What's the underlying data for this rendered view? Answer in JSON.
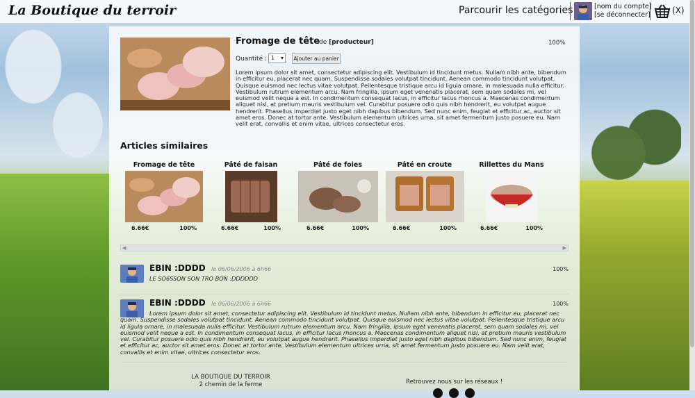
{
  "header": {
    "brand": "La Boutique du terroir",
    "browse_categories": "Parcourir les catégories",
    "account_name": "[nom du compte]",
    "logout": "[se déconnecter]",
    "cart_count": "(X)"
  },
  "product": {
    "title": "Fromage de tête",
    "by": "de",
    "producer": "[producteur]",
    "percent": "100%",
    "quantity_label": "Quantité :",
    "quantity_value": "1",
    "add_to_cart": "Ajouter au panier",
    "description": "Lorem ipsum dolor sit amet, consectetur adipiscing elit. Vestibulum id tincidunt metus. Nullam nibh ante, bibendum in efficitur eu, placerat nec quam. Suspendisse sodales volutpat tincidunt. Aenean commodo tincidunt volutpat. Quisque euismod nec lectus vitae volutpat. Pellentesque tristique arcu id ligula ornare, in malesuada nulla efficitur. Vestibulum rutrum elementum arcu. Nam fringilla, ipsum eget venenatis placerat, sem quam sodales mi, vel euismod velit neque a est. In condimentum consequat lacus, in efficitur lacus rhoncus a. Maecenas condimentum aliquet nisl, at pretium mauris vestibulum vel. Curabitur posuere odio quis nibh hendrerit, eu volutpat augue hendrerit. Phasellus imperdiet justo eget nibh dapibus bibendum. Sed nunc enim, feugiat et efficitur ac, auctor sit amet eros. Donec at tortor ante. Vestibulum elementum ultrices urna, sit amet fermentum justo posuere eu. Nam velit erat, convallis et enim vitae, ultrices consectetur eros."
  },
  "similar": {
    "title": "Articles similaires",
    "items": [
      {
        "name": "Fromage de tête",
        "price": "6.66€",
        "percent": "100%"
      },
      {
        "name": "Pâté de faisan",
        "price": "6.66€",
        "percent": "100%"
      },
      {
        "name": "Pâté de foies",
        "price": "6.66€",
        "percent": "100%"
      },
      {
        "name": "Pâté en croute",
        "price": "6.66€",
        "percent": "100%"
      },
      {
        "name": "Rillettes du Mans",
        "price": "6.66€",
        "percent": "100%"
      }
    ]
  },
  "comments": [
    {
      "author": "EBIN :DDDD",
      "date": "le 06/06/2006 à 6h66",
      "percent": "100%",
      "text": "LE SO6SSON SON TRO BON :DDDDDD"
    },
    {
      "author": "EBIN :DDDD",
      "date": "le 06/06/2006 à 6h66",
      "percent": "100%",
      "text": "Lorem ipsum dolor sit amet, consectetur adipiscing elit. Vestibulum id tincidunt metus. Nullam nibh ante, bibendum in efficitur eu, placerat nec quam. Suspendisse sodales volutpat tincidunt. Aenean commodo tincidunt volutpat. Quisque euismod nec lectus vitae volutpat. Pellentesque tristique arcu id ligula ornare, in malesuada nulla efficitur. Vestibulum rutrum elementum arcu. Nam fringilla, ipsum eget venenatis placerat, sem quam sodales mi, vel euismod velit neque a est. In condimentum consequat lacus, in efficitur lacus rhoncus a. Maecenas condimentum aliquet nisl, at pretium mauris vestibulum vel. Curabitur posuere odio quis nibh hendrerit, eu volutpat augue hendrerit. Phasellus imperdiet justo eget nibh dapibus bibendum. Sed nunc enim, feugiat et efficitur ac, auctor sit amet eros. Donec at tortor ante. Vestibulum elementum ultrices urna, sit amet fermentum justo posuere eu. Nam velit erat, convallis et enim vitae, ultrices consectetur eros."
    }
  ],
  "footer": {
    "shop_name": "LA BOUTIQUE DU TERROIR",
    "address": "2 chemin de la ferme",
    "social_text": "Retrouvez nous sur les réseaux !"
  },
  "icons": [
    "basket-icon",
    "avatar",
    "facebook-icon",
    "twitter-icon",
    "instagram-icon"
  ]
}
